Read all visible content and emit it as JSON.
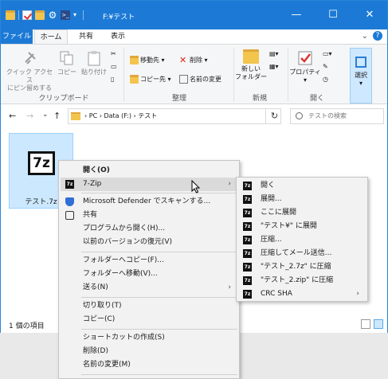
{
  "window": {
    "title": "F:¥テスト",
    "minimize": "—",
    "maximize": "☐",
    "close": "✕"
  },
  "tabs": [
    {
      "label": "ファイル"
    },
    {
      "label": "ホーム"
    },
    {
      "label": "共有"
    },
    {
      "label": "表示"
    }
  ],
  "ribbon": {
    "clipboard": {
      "group": "クリップボード",
      "pin": "クイック アクセス\nにピン留めする",
      "copy": "コピー",
      "paste": "貼り付け"
    },
    "organize": {
      "group": "整理",
      "move_to": "移動先 ▾",
      "copy_to": "コピー先 ▾",
      "delete": "削除 ▾",
      "rename": "名前の変更"
    },
    "new": {
      "group": "新規",
      "new_folder": "新しい\nフォルダー"
    },
    "open": {
      "group": "開く",
      "properties": "プロパティ\n▾"
    },
    "select": {
      "label": "選択\n▾"
    }
  },
  "address": {
    "back": "←",
    "forward": "→",
    "recent": "⌄",
    "up": "↑",
    "path": "› PC › Data (F:) › テスト",
    "refresh": "↻",
    "search_placeholder": "テストの検索"
  },
  "file": {
    "name": "テスト.7z",
    "icon_text": "7z"
  },
  "status": {
    "count": "1 個の項目"
  },
  "context_menu": {
    "items": [
      {
        "label": "開く(O)"
      },
      {
        "label": "7-Zip"
      },
      {
        "label": "Microsoft Defender でスキャンする..."
      },
      {
        "label": "共有"
      },
      {
        "label": "プログラムから開く(H)..."
      },
      {
        "label": "以前のバージョンの復元(V)"
      },
      {
        "label": "フォルダーへコピー(F)..."
      },
      {
        "label": "フォルダーへ移動(V)..."
      },
      {
        "label": "送る(N)"
      },
      {
        "label": "切り取り(T)"
      },
      {
        "label": "コピー(C)"
      },
      {
        "label": "ショートカットの作成(S)"
      },
      {
        "label": "削除(D)"
      },
      {
        "label": "名前の変更(M)"
      }
    ]
  },
  "submenu": {
    "items": [
      {
        "label": "開く"
      },
      {
        "label": "展開..."
      },
      {
        "label": "ここに展開"
      },
      {
        "label": "\"テスト¥\" に展開"
      },
      {
        "label": "圧縮..."
      },
      {
        "label": "圧縮してメール送信..."
      },
      {
        "label": "\"テスト_2.7z\" に圧縮"
      },
      {
        "label": "\"テスト_2.zip\" に圧縮"
      },
      {
        "label": "CRC SHA"
      }
    ],
    "icon_text": "7z"
  }
}
